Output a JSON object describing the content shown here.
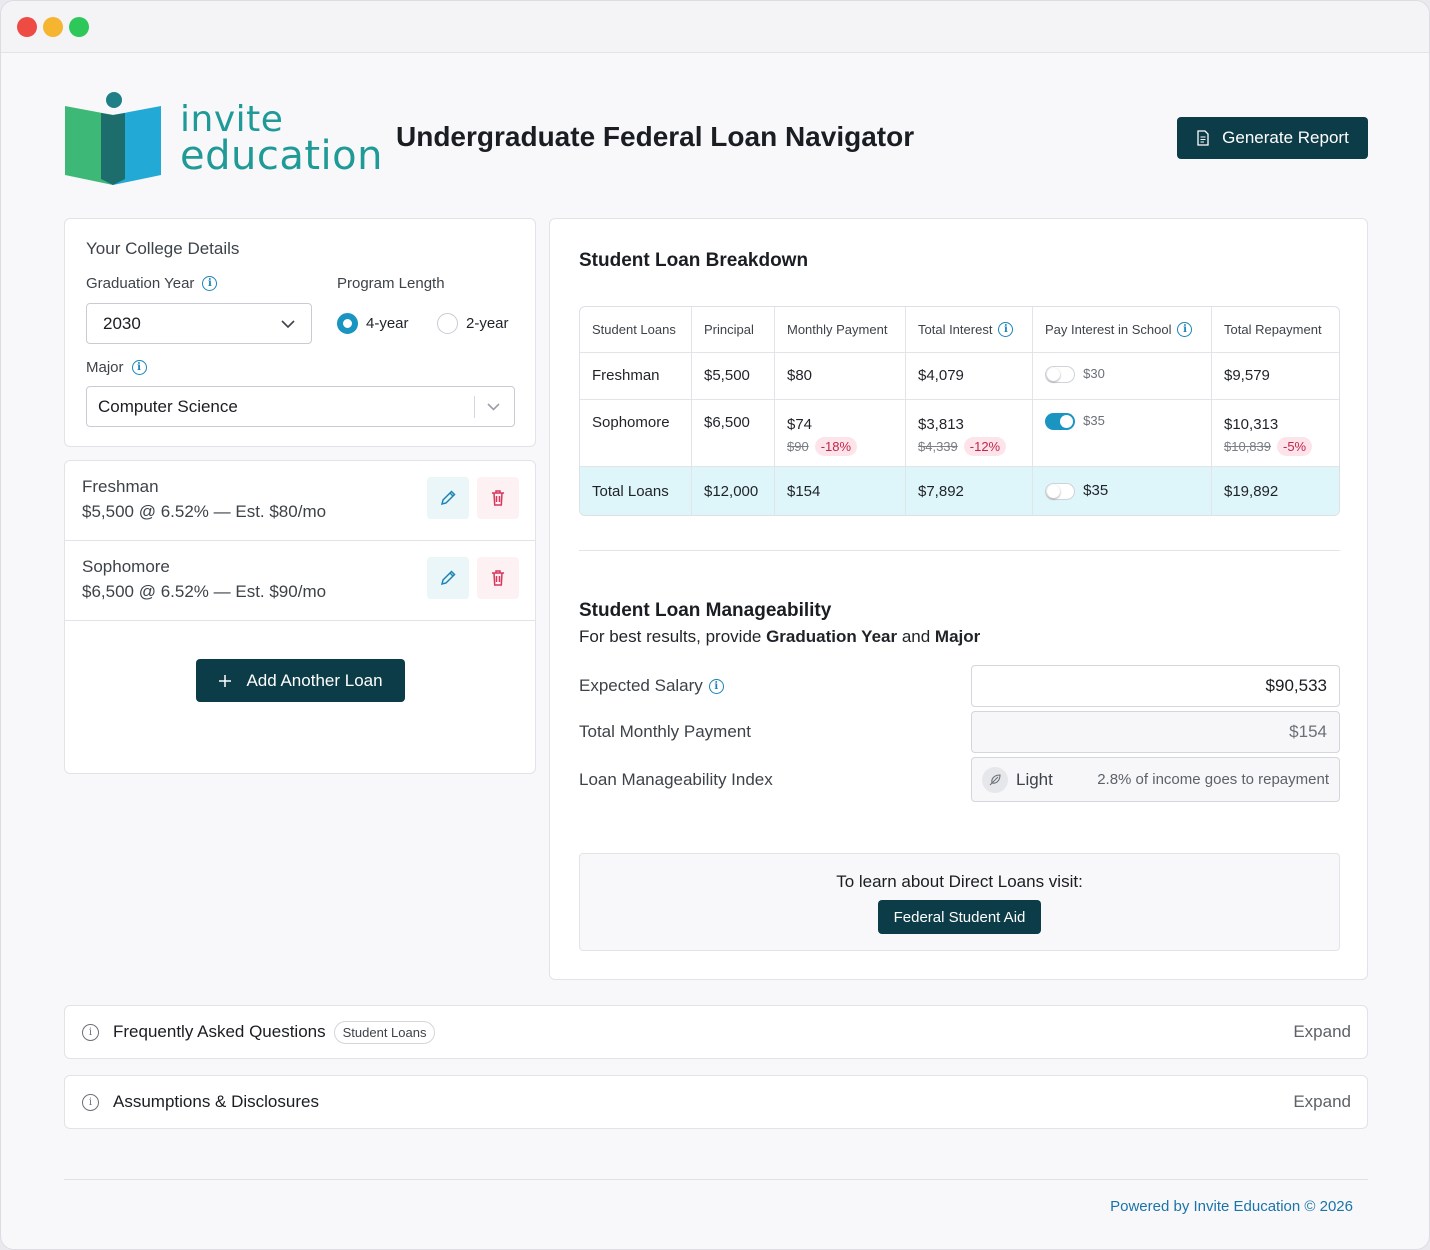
{
  "window": {
    "buttons": [
      "close",
      "minimize",
      "zoom"
    ]
  },
  "header": {
    "logo_line1": "invite",
    "logo_line2": "education",
    "title": "Undergraduate Federal Loan Navigator",
    "report_button": "Generate Report",
    "report_icon": "document-icon"
  },
  "college": {
    "heading": "Your College Details",
    "grad_year_label": "Graduation Year",
    "grad_year_value": "2030",
    "program_label": "Program Length",
    "program_options": [
      "4-year",
      "2-year"
    ],
    "program_selected": "4-year",
    "major_label": "Major",
    "major_value": "Computer Science"
  },
  "loans": [
    {
      "name": "Freshman",
      "desc": "$5,500 @ 6.52% — Est. $80/mo"
    },
    {
      "name": "Sophomore",
      "desc": "$6,500 @ 6.52% — Est. $90/mo"
    }
  ],
  "add_loan_label": "Add Another Loan",
  "breakdown": {
    "title": "Student Loan Breakdown",
    "columns": [
      "Student Loans",
      "Principal",
      "Monthly Payment",
      "Total Interest",
      "Pay Interest in School",
      "Total Repayment"
    ],
    "rows": [
      {
        "name": "Freshman",
        "principal": "$5,500",
        "monthly": "$80",
        "interest": "$4,079",
        "pay_in_school": "$30",
        "pay_in_school_on": false,
        "repayment": "$9,579"
      },
      {
        "name": "Sophomore",
        "principal": "$6,500",
        "monthly": "$74",
        "monthly_old": "$90",
        "monthly_delta": "-18%",
        "interest": "$3,813",
        "interest_old": "$4,339",
        "interest_delta": "-12%",
        "pay_in_school": "$35",
        "pay_in_school_on": true,
        "repayment": "$10,313",
        "repayment_old": "$10,839",
        "repayment_delta": "-5%"
      }
    ],
    "total": {
      "name": "Total Loans",
      "principal": "$12,000",
      "monthly": "$154",
      "interest": "$7,892",
      "pay_in_school": "$35",
      "repayment": "$19,892"
    }
  },
  "manageability": {
    "title": "Student Loan Manageability",
    "subtitle_prefix": "For best results, provide ",
    "subtitle_bold1": "Graduation Year",
    "subtitle_mid": " and ",
    "subtitle_bold2": "Major",
    "salary_label": "Expected Salary",
    "salary_value": "$90,533",
    "monthly_label": "Total Monthly Payment",
    "monthly_value": "$154",
    "index_label": "Loan Manageability Index",
    "index_value": "Light",
    "index_note": "2.8% of income goes to repayment"
  },
  "learn": {
    "text": "To learn about Direct Loans visit:",
    "button": "Federal Student Aid"
  },
  "faq": {
    "title": "Frequently Asked Questions",
    "chip": "Student Loans",
    "action": "Expand"
  },
  "assumptions": {
    "title": "Assumptions & Disclosures",
    "action": "Expand"
  },
  "footer": "Powered by Invite Education © 2026",
  "colors": {
    "brand_dark": "#0c3c47",
    "accent": "#1a94c0",
    "logo_teal": "#1f9a97",
    "total_row": "#def6f9",
    "negative": "#c2254a"
  }
}
